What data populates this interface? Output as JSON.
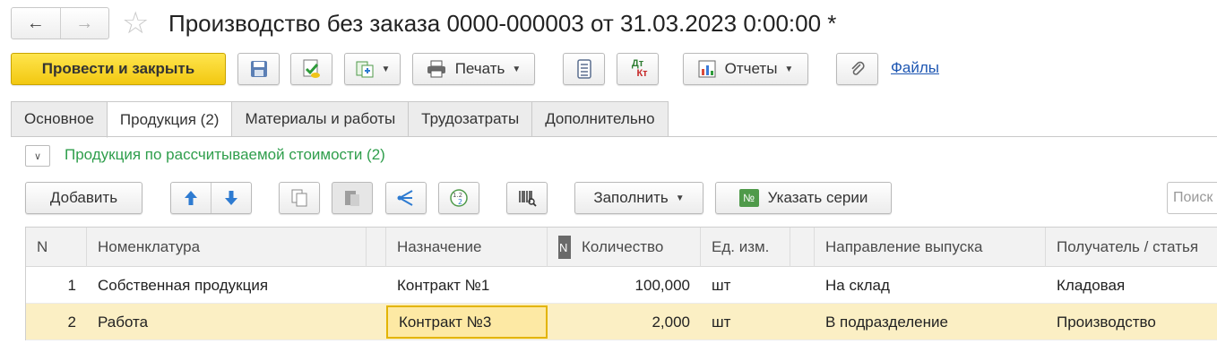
{
  "title": "Производство без заказа 0000-000003 от 31.03.2023 0:00:00 *",
  "toolbar": {
    "post_close": "Провести и закрыть",
    "print": "Печать",
    "dtkt_top": "Дт",
    "dtkt_bottom": "Кт",
    "reports": "Отчеты",
    "files": "Файлы"
  },
  "tabs": [
    "Основное",
    "Продукция (2)",
    "Материалы и работы",
    "Трудозатраты",
    "Дополнительно"
  ],
  "group": {
    "title": "Продукция по рассчитываемой стоимости (2)"
  },
  "table_toolbar": {
    "add": "Добавить",
    "fill": "Заполнить",
    "series": "Указать серии",
    "series_badge": "№",
    "search_placeholder": "Поиск"
  },
  "table": {
    "columns": [
      "N",
      "Номенклатура",
      "Назначение",
      "N",
      "Количество",
      "Ед. изм.",
      "Направление выпуска",
      "Получатель / статья"
    ],
    "rows": [
      {
        "n": "1",
        "item": "Собственная продукция",
        "purpose": "Контракт №1",
        "qty": "100,000",
        "unit": "шт",
        "direction": "На склад",
        "recipient": "Кладовая"
      },
      {
        "n": "2",
        "item": "Работа",
        "purpose": "Контракт №3",
        "qty": "2,000",
        "unit": "шт",
        "direction": "В подразделение",
        "recipient": "Производство"
      }
    ]
  },
  "colors": {
    "accent": "#f2c811",
    "group_title": "#2f9e4c",
    "link": "#1d56b2",
    "selected_row": "#fbefc4"
  }
}
